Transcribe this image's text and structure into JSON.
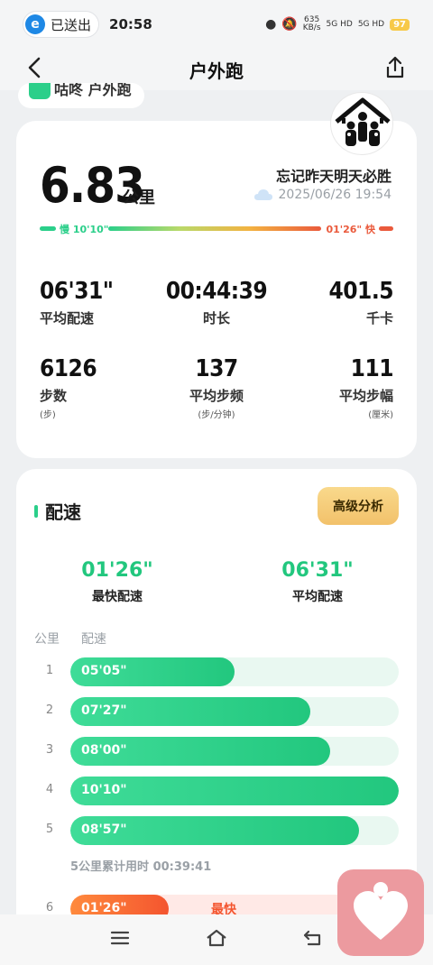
{
  "status_bar": {
    "sent_label": "已送出",
    "time": "20:58",
    "net_speed": "635",
    "net_unit": "KB/s",
    "sig1": "5G HD",
    "sig2": "5G HD",
    "battery": "97"
  },
  "header": {
    "title": "户外跑",
    "back_icon": "chevron-left-icon",
    "share_icon": "share-icon"
  },
  "app_chip": {
    "text": "咕咚 户外跑"
  },
  "run": {
    "distance": "6.83",
    "distance_unit": "公里",
    "motto": "忘记昨天明天必胜",
    "datetime": "2025/06/26 19:54",
    "weather_icon": "cloud-icon",
    "pace_slow_label": "慢 10'10\"",
    "pace_fast_label": "01'26\" 快"
  },
  "stats": {
    "avg_pace": {
      "value": "06'31\"",
      "label": "平均配速"
    },
    "duration": {
      "value": "00:44:39",
      "label": "时长"
    },
    "calories": {
      "value": "401.5",
      "label": "千卡"
    },
    "steps": {
      "value": "6126",
      "label": "步数",
      "unit": "(步)"
    },
    "cadence": {
      "value": "137",
      "label": "平均步频",
      "unit": "(步/分钟)"
    },
    "stride": {
      "value": "111",
      "label": "平均步幅",
      "unit": "(厘米)"
    }
  },
  "pace_section": {
    "title": "配速",
    "advanced_btn": "高级分析",
    "fastest": {
      "value": "01'26\"",
      "label": "最快配速"
    },
    "average": {
      "value": "06'31\"",
      "label": "平均配速"
    },
    "col_km": "公里",
    "col_pace": "配速",
    "splits": [
      {
        "km": "1",
        "pace": "05'05\"",
        "fill": 0.5
      },
      {
        "km": "2",
        "pace": "07'27\"",
        "fill": 0.73
      },
      {
        "km": "3",
        "pace": "08'00\"",
        "fill": 0.79
      },
      {
        "km": "4",
        "pace": "10'10\"",
        "fill": 1.0
      },
      {
        "km": "5",
        "pace": "08'57\"",
        "fill": 0.88
      },
      {
        "km": "6",
        "pace": "01'26\"",
        "fill": 0.3,
        "tag": "最快"
      }
    ],
    "cumulative": "5公里累计用时 00:39:41"
  },
  "colors": {
    "accent_green": "#22c77e",
    "fast_red": "#f4552f",
    "advanced_gold": "#f2c16a"
  }
}
